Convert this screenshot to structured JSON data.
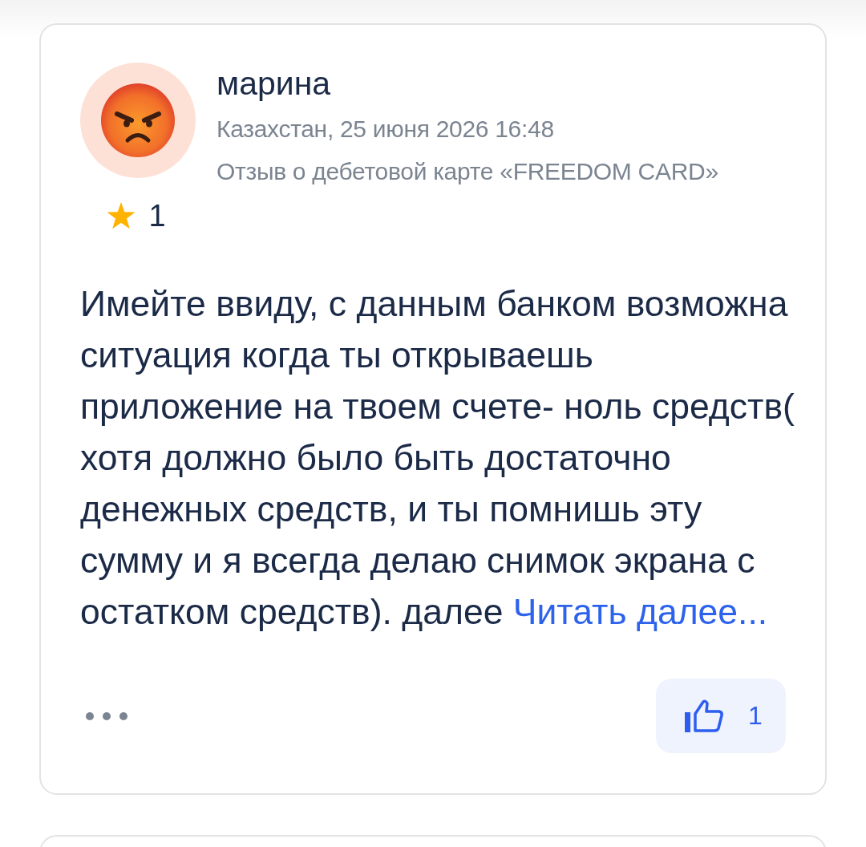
{
  "review": {
    "author": "марина",
    "location_date": "Казахстан, 25 июня 2026 16:48",
    "subject": "Отзыв о дебетовой карте «FREEDOM CARD»",
    "rating": "1",
    "text": "Имейте ввиду, с данным банком возможна ситуация когда ты открываешь приложение на твоем счете- ноль средств( хотя должно было быть достаточно денежных средств, и ты помнишь эту сумму и я всегда делаю снимок экрана с остатком средств). далее",
    "read_more": "Читать далее...",
    "likes": "1"
  }
}
